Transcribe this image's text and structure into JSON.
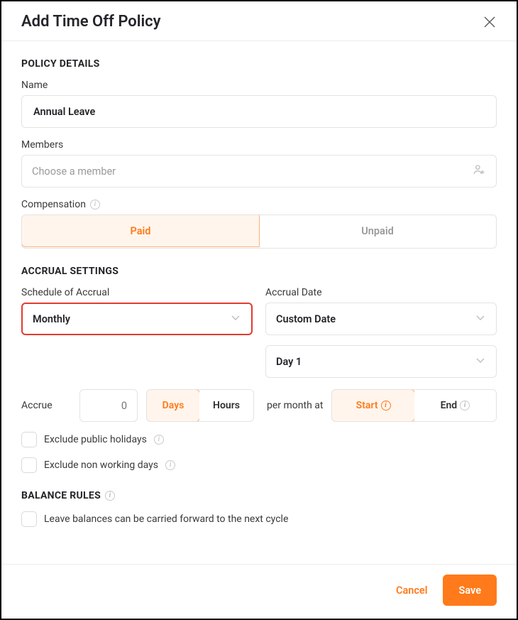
{
  "header": {
    "title": "Add Time Off Policy"
  },
  "policy": {
    "section_title": "POLICY DETAILS",
    "name_label": "Name",
    "name_value": "Annual Leave",
    "members_label": "Members",
    "members_placeholder": "Choose a member",
    "compensation_label": "Compensation",
    "compensation": {
      "paid": "Paid",
      "unpaid": "Unpaid"
    }
  },
  "accrual": {
    "section_title": "ACCRUAL SETTINGS",
    "schedule_label": "Schedule of Accrual",
    "schedule_value": "Monthly",
    "date_label": "Accrual Date",
    "date_value": "Custom Date",
    "day_value": "Day 1",
    "accrue_label": "Accrue",
    "accrue_value": "0",
    "unit": {
      "days": "Days",
      "hours": "Hours"
    },
    "per_label": "per month at",
    "timing": {
      "start": "Start",
      "end": "End"
    },
    "exclude_ph": "Exclude public holidays",
    "exclude_nwd": "Exclude non working days"
  },
  "balance": {
    "section_title": "BALANCE RULES",
    "carry_forward": "Leave balances can be carried forward to the next cycle"
  },
  "footer": {
    "cancel": "Cancel",
    "save": "Save"
  }
}
